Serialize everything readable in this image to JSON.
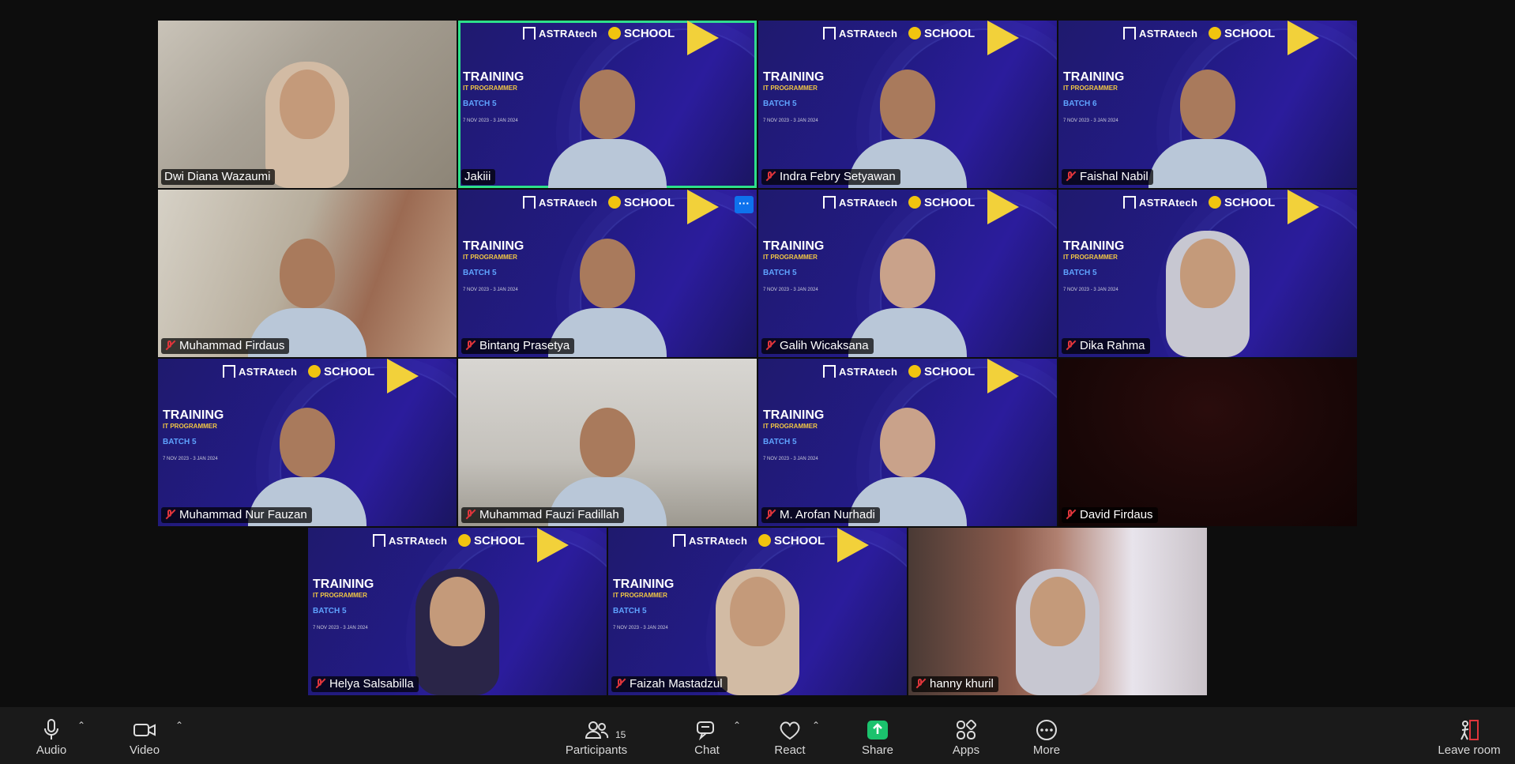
{
  "participants": [
    {
      "name": "Dwi Diana Wazaumi",
      "muted": false,
      "bg": "room",
      "person": "hijab",
      "active": false
    },
    {
      "name": "Jakiii",
      "muted": false,
      "bg": "banner",
      "person": "plain",
      "active": true
    },
    {
      "name": "Indra Febry Setyawan",
      "muted": true,
      "bg": "banner",
      "person": "plain",
      "active": false
    },
    {
      "name": "Faishal Nabil",
      "muted": true,
      "bg": "banner",
      "person": "plain",
      "active": false
    },
    {
      "name": "Muhammad Firdaus",
      "muted": true,
      "bg": "room2",
      "person": "plain",
      "active": false
    },
    {
      "name": "Bintang Prasetya",
      "muted": true,
      "bg": "banner",
      "person": "plain",
      "active": false
    },
    {
      "name": "Galih Wicaksana",
      "muted": true,
      "bg": "banner",
      "person": "pale",
      "active": false
    },
    {
      "name": "Dika Rahma",
      "muted": true,
      "bg": "banner",
      "person": "hijab-grey",
      "active": false
    },
    {
      "name": "Muhammad Nur Fauzan",
      "muted": true,
      "bg": "banner",
      "person": "plain",
      "active": false
    },
    {
      "name": "Muhammad Fauzi Fadillah",
      "muted": true,
      "bg": "room3",
      "person": "plain",
      "active": false
    },
    {
      "name": "M. Arofan Nurhadi",
      "muted": true,
      "bg": "banner",
      "person": "pale",
      "active": false
    },
    {
      "name": "David Firdaus",
      "muted": true,
      "bg": "dark",
      "person": "none",
      "active": false
    },
    {
      "name": "Helya Salsabilla",
      "muted": true,
      "bg": "banner",
      "person": "hijab-dark",
      "active": false
    },
    {
      "name": "Faizah Mastadzul",
      "muted": true,
      "bg": "banner",
      "person": "hijab",
      "active": false
    },
    {
      "name": "hanny khuril",
      "muted": true,
      "bg": "room4",
      "person": "hijab-grey",
      "active": false
    }
  ],
  "banner": {
    "brand": "ASTRAtech",
    "school": "SCHOOL",
    "title": "TRAINING",
    "subtitle": "IT PROGRAMMER",
    "batch": "BATCH 5",
    "batch_alt": "BATCH 6",
    "dates": "7 NOV 2023 - 3 JAN 2024"
  },
  "tile_menu_label": "···",
  "toolbar": {
    "audio": "Audio",
    "video": "Video",
    "participants": "Participants",
    "participants_count": "15",
    "chat": "Chat",
    "react": "React",
    "share": "Share",
    "apps": "Apps",
    "more": "More",
    "leave": "Leave room"
  },
  "colors": {
    "active_outline": "#2de08a",
    "muted_icon": "#e0353b",
    "share_green": "#1bc26d",
    "banner_blue": "#231b86"
  }
}
